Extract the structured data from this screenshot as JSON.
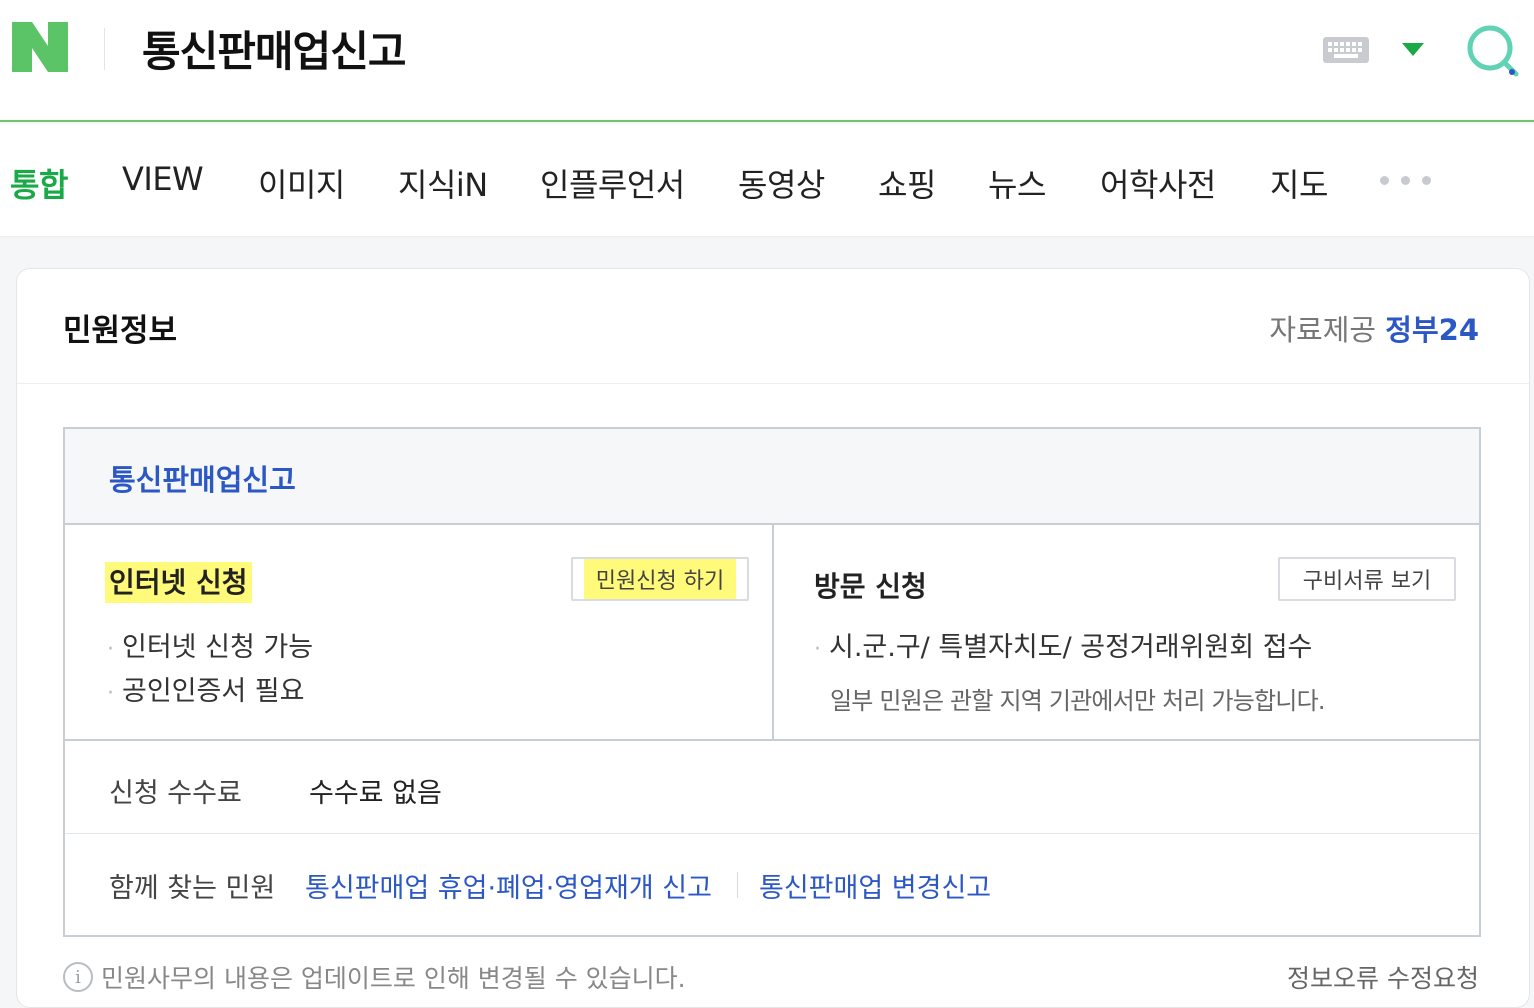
{
  "header": {
    "logo_letter": "N",
    "query": "통신판매업신고",
    "icons": [
      "keyboard-icon",
      "caret-down-icon",
      "search-icon"
    ],
    "accent": "#19a946"
  },
  "tabs": [
    {
      "label": "통합",
      "active": true
    },
    {
      "label": "VIEW"
    },
    {
      "label": "이미지"
    },
    {
      "label": "지식iN"
    },
    {
      "label": "인플루언서"
    },
    {
      "label": "동영상"
    },
    {
      "label": "쇼핑"
    },
    {
      "label": "뉴스"
    },
    {
      "label": "어학사전"
    },
    {
      "label": "지도"
    }
  ],
  "card": {
    "title": "민원정보",
    "source_label": "자료제공",
    "source_name": "정부24",
    "service_title": "통신판매업신고",
    "online": {
      "title": "인터넷 신청",
      "button": "민원신청 하기",
      "bullets": [
        "인터넷 신청 가능",
        "공인인증서 필요"
      ]
    },
    "visit": {
      "title": "방문 신청",
      "button": "구비서류 보기",
      "bullets": [
        "시.군.구/ 특별자치도/ 공정거래위원회 접수"
      ],
      "note": "일부 민원은 관할 지역 기관에서만 처리 가능합니다."
    },
    "fee": {
      "label": "신청 수수료",
      "value": "수수료 없음"
    },
    "related": {
      "label": "함께 찾는 민원",
      "links": [
        "통신판매업 휴업·폐업·영업재개 신고",
        "통신판매업 변경신고"
      ]
    },
    "footer_note": "민원사무의 내용은 업데이트로 인해 변경될 수 있습니다.",
    "footer_link": "정보오류 수정요청"
  },
  "colors": {
    "link_blue": "#2c58c5",
    "highlight": "#fffa7a"
  }
}
